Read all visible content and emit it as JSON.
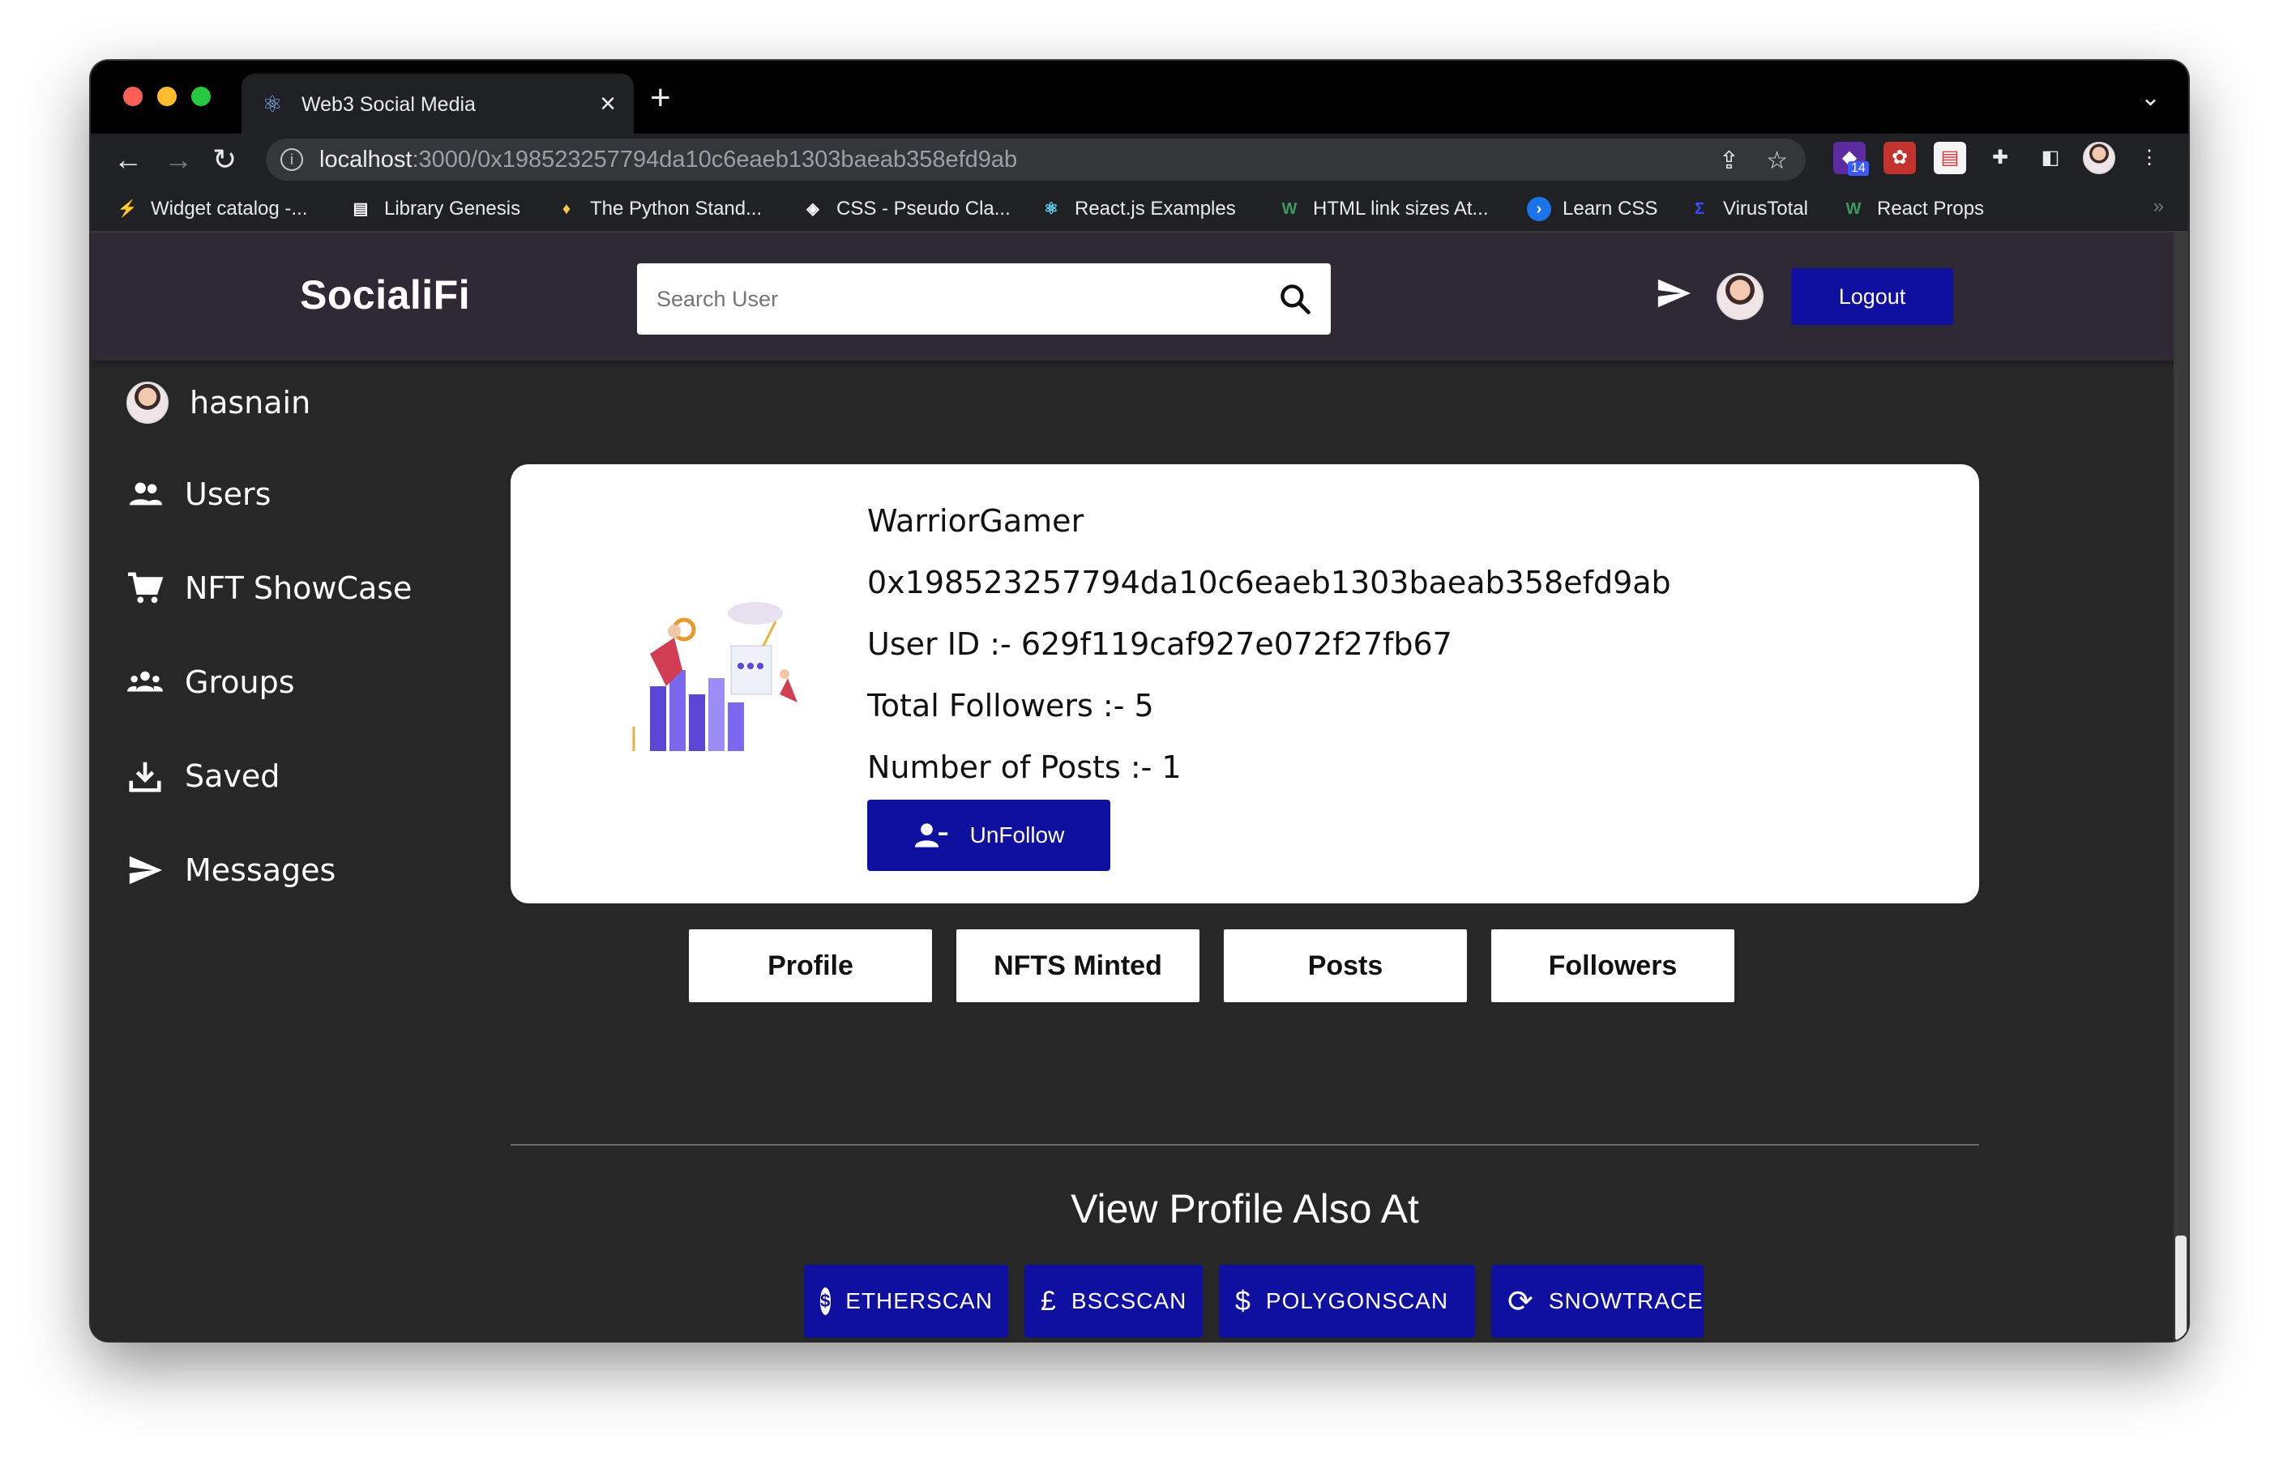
{
  "browser": {
    "tab_title": "Web3 Social Media",
    "url_host": "localhost",
    "url_path": ":3000/0x198523257794da10c6eaeb1303baeab358efd9ab",
    "extension_badge": "14",
    "bookmarks": [
      {
        "label": "Widget catalog -...",
        "color": "#4c8bf5"
      },
      {
        "label": "Library Genesis",
        "color": "#ffffff"
      },
      {
        "label": "The Python Stand...",
        "color": "#f7c948"
      },
      {
        "label": "CSS - Pseudo Cla...",
        "color": "#ffffff"
      },
      {
        "label": "React.js Examples",
        "color": "#61dafb"
      },
      {
        "label": "HTML link sizes At...",
        "color": "#3c9a5f"
      },
      {
        "label": "Learn CSS",
        "color": "#1a73e8"
      },
      {
        "label": "VirusTotal",
        "color": "#394eff"
      },
      {
        "label": "React Props",
        "color": "#3c9a5f"
      }
    ]
  },
  "app": {
    "logo": "SocialiFi",
    "search_placeholder": "Search User",
    "logout_label": "Logout",
    "accent": "#1010a0"
  },
  "sidebar": {
    "username": "hasnain",
    "items": [
      {
        "label": "Users",
        "icon": "users-icon"
      },
      {
        "label": "NFT ShowCase",
        "icon": "cart-icon"
      },
      {
        "label": "Groups",
        "icon": "groups-icon"
      },
      {
        "label": "Saved",
        "icon": "download-icon"
      },
      {
        "label": "Messages",
        "icon": "send-icon"
      }
    ]
  },
  "profile": {
    "name": "WarriorGamer",
    "address": "0x198523257794da10c6eaeb1303baeab358efd9ab",
    "user_id_line": "User ID :- 629f119caf927e072f27fb67",
    "followers_line": "Total Followers :- 5",
    "posts_line": "Number of Posts :- 1",
    "unfollow_label": "UnFollow"
  },
  "tabs": [
    "Profile",
    "NFTS Minted",
    "Posts",
    "Followers"
  ],
  "explorers": {
    "heading": "View Profile Also At",
    "buttons": [
      {
        "label": "ETHERSCAN",
        "icon": "dollar-circle-icon",
        "glyph": "$"
      },
      {
        "label": "BSCSCAN",
        "icon": "pound-icon",
        "glyph": "£"
      },
      {
        "label": "POLYGONSCAN",
        "icon": "dollar-icon",
        "glyph": "$"
      },
      {
        "label": "SNOWTRACE",
        "icon": "currency-exchange-icon",
        "glyph": "⟳"
      }
    ]
  }
}
